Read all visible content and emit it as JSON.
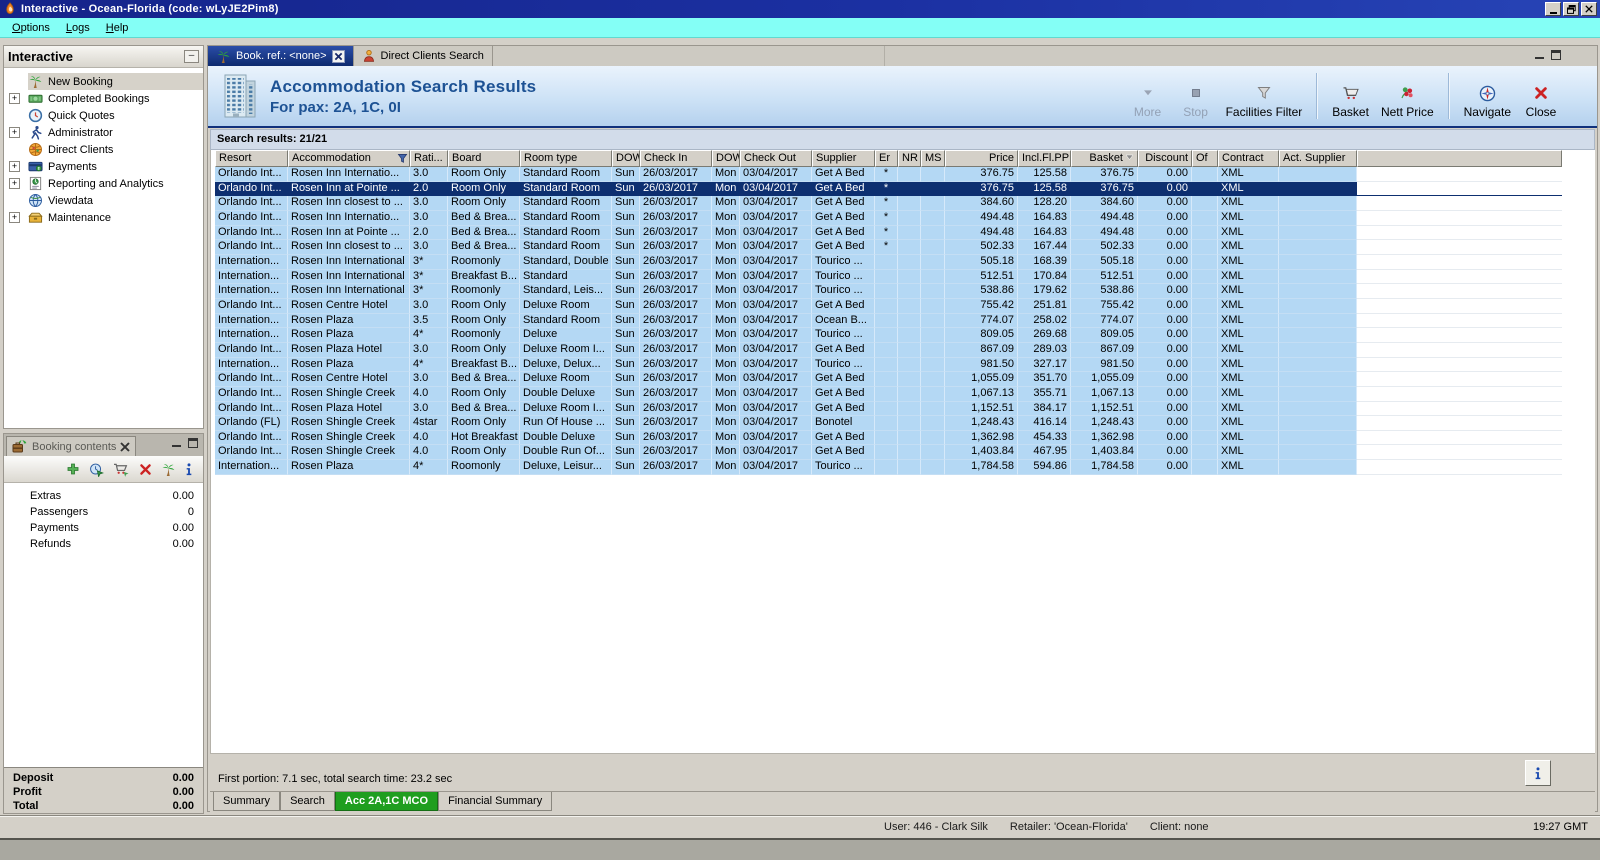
{
  "window": {
    "title": "Interactive - Ocean-Florida (code: wLyJE2Pim8)",
    "menu": [
      "Options",
      "Logs",
      "Help"
    ]
  },
  "sidebar": {
    "title": "Interactive",
    "items": [
      {
        "label": "New Booking",
        "icon": "palm",
        "expandable": false,
        "selected": true
      },
      {
        "label": "Completed Bookings",
        "icon": "money",
        "expandable": true,
        "selected": false
      },
      {
        "label": "Quick Quotes",
        "icon": "clock",
        "expandable": false,
        "selected": false
      },
      {
        "label": "Administrator",
        "icon": "runner",
        "expandable": true,
        "selected": false
      },
      {
        "label": "Direct Clients",
        "icon": "globered",
        "expandable": false,
        "selected": false
      },
      {
        "label": "Payments",
        "icon": "payment",
        "expandable": true,
        "selected": false
      },
      {
        "label": "Reporting and Analytics",
        "icon": "report",
        "expandable": true,
        "selected": false
      },
      {
        "label": "Viewdata",
        "icon": "globeblue",
        "expandable": false,
        "selected": false
      },
      {
        "label": "Maintenance",
        "icon": "box",
        "expandable": true,
        "selected": false
      }
    ]
  },
  "booking_contents": {
    "title": "Booking contents",
    "toolbar": [
      "add",
      "quote",
      "cartadd",
      "remove",
      "palm",
      "info"
    ],
    "rows": [
      {
        "label": "Extras",
        "value": "0.00"
      },
      {
        "label": "Passengers",
        "value": "0"
      },
      {
        "label": "Payments",
        "value": "0.00"
      },
      {
        "label": "Refunds",
        "value": "0.00"
      }
    ],
    "totals": [
      {
        "label": "Deposit",
        "value": "0.00"
      },
      {
        "label": "Profit",
        "value": "0.00"
      },
      {
        "label": "Total",
        "value": "0.00"
      }
    ]
  },
  "status": {
    "user": "User: 446 - Clark Silk",
    "retailer": "Retailer: 'Ocean-Florida'",
    "client": "Client: none",
    "time": "19:27 GMT"
  },
  "main": {
    "tabs": [
      {
        "label": "Book. ref.: <none>",
        "icon": "palm",
        "active": true,
        "closable": true
      },
      {
        "label": "Direct Clients Search",
        "icon": "person",
        "active": false,
        "closable": false
      }
    ],
    "header": {
      "title": "Accommodation Search Results",
      "subtitle": "For pax: 2A, 1C, 0I"
    },
    "toolbar": [
      {
        "label": "More",
        "icon": "more",
        "disabled": true
      },
      {
        "label": "Stop",
        "icon": "stop",
        "disabled": true
      },
      {
        "label": "Facilities Filter",
        "icon": "funnel",
        "disabled": false
      },
      {
        "sep": true
      },
      {
        "label": "Basket",
        "icon": "cart",
        "disabled": false
      },
      {
        "label": "Nett Price",
        "icon": "flower",
        "disabled": false
      },
      {
        "sep": true
      },
      {
        "label": "Navigate",
        "icon": "compass",
        "disabled": false
      },
      {
        "label": "Close",
        "icon": "closex",
        "disabled": false
      }
    ],
    "results": {
      "summary": "Search results: 21/21",
      "timing": "First portion: 7.1 sec, total search time: 23.2 sec"
    },
    "grid": {
      "columns": [
        {
          "label": "Resort"
        },
        {
          "label": "Accommodation",
          "filter": true
        },
        {
          "label": "Rati..."
        },
        {
          "label": "Board"
        },
        {
          "label": "Room type"
        },
        {
          "label": "DOW"
        },
        {
          "label": "Check In"
        },
        {
          "label": "DOW"
        },
        {
          "label": "Check Out"
        },
        {
          "label": "Supplier"
        },
        {
          "label": "Er"
        },
        {
          "label": "NR"
        },
        {
          "label": "MS"
        },
        {
          "label": "Price"
        },
        {
          "label": "Incl.Fl.PP"
        },
        {
          "label": "Basket",
          "sort": "desc"
        },
        {
          "label": "Discount"
        },
        {
          "label": "Of"
        },
        {
          "label": "Contract"
        },
        {
          "label": "Act. Supplier"
        }
      ],
      "selected_index": 1,
      "rows": [
        [
          "Orlando Int...",
          "Rosen Inn Internatio...",
          "3.0",
          "Room Only",
          "Standard Room",
          "Sun",
          "26/03/2017",
          "Mon",
          "03/04/2017",
          "Get A Bed",
          "*",
          "",
          "",
          "376.75",
          "125.58",
          "376.75",
          "0.00",
          "",
          "XML",
          ""
        ],
        [
          "Orlando Int...",
          "Rosen Inn at Pointe ...",
          "2.0",
          "Room Only",
          "Standard Room",
          "Sun",
          "26/03/2017",
          "Mon",
          "03/04/2017",
          "Get A Bed",
          "*",
          "",
          "",
          "376.75",
          "125.58",
          "376.75",
          "0.00",
          "",
          "XML",
          ""
        ],
        [
          "Orlando Int...",
          "Rosen Inn closest to ...",
          "3.0",
          "Room Only",
          "Standard Room",
          "Sun",
          "26/03/2017",
          "Mon",
          "03/04/2017",
          "Get A Bed",
          "*",
          "",
          "",
          "384.60",
          "128.20",
          "384.60",
          "0.00",
          "",
          "XML",
          ""
        ],
        [
          "Orlando Int...",
          "Rosen Inn Internatio...",
          "3.0",
          "Bed & Brea...",
          "Standard Room",
          "Sun",
          "26/03/2017",
          "Mon",
          "03/04/2017",
          "Get A Bed",
          "*",
          "",
          "",
          "494.48",
          "164.83",
          "494.48",
          "0.00",
          "",
          "XML",
          ""
        ],
        [
          "Orlando Int...",
          "Rosen Inn at Pointe ...",
          "2.0",
          "Bed & Brea...",
          "Standard Room",
          "Sun",
          "26/03/2017",
          "Mon",
          "03/04/2017",
          "Get A Bed",
          "*",
          "",
          "",
          "494.48",
          "164.83",
          "494.48",
          "0.00",
          "",
          "XML",
          ""
        ],
        [
          "Orlando Int...",
          "Rosen Inn closest to ...",
          "3.0",
          "Bed & Brea...",
          "Standard Room",
          "Sun",
          "26/03/2017",
          "Mon",
          "03/04/2017",
          "Get A Bed",
          "*",
          "",
          "",
          "502.33",
          "167.44",
          "502.33",
          "0.00",
          "",
          "XML",
          ""
        ],
        [
          "Internation...",
          "Rosen Inn International",
          "3*",
          "Roomonly",
          "Standard, Double",
          "Sun",
          "26/03/2017",
          "Mon",
          "03/04/2017",
          "Tourico ...",
          "",
          "",
          "",
          "505.18",
          "168.39",
          "505.18",
          "0.00",
          "",
          "XML",
          ""
        ],
        [
          "Internation...",
          "Rosen Inn International",
          "3*",
          "Breakfast B...",
          "Standard",
          "Sun",
          "26/03/2017",
          "Mon",
          "03/04/2017",
          "Tourico ...",
          "",
          "",
          "",
          "512.51",
          "170.84",
          "512.51",
          "0.00",
          "",
          "XML",
          ""
        ],
        [
          "Internation...",
          "Rosen Inn International",
          "3*",
          "Roomonly",
          "Standard, Leis...",
          "Sun",
          "26/03/2017",
          "Mon",
          "03/04/2017",
          "Tourico ...",
          "",
          "",
          "",
          "538.86",
          "179.62",
          "538.86",
          "0.00",
          "",
          "XML",
          ""
        ],
        [
          "Orlando Int...",
          "Rosen Centre Hotel",
          "3.0",
          "Room Only",
          "Deluxe Room",
          "Sun",
          "26/03/2017",
          "Mon",
          "03/04/2017",
          "Get A Bed",
          "",
          "",
          "",
          "755.42",
          "251.81",
          "755.42",
          "0.00",
          "",
          "XML",
          ""
        ],
        [
          "Internation...",
          "Rosen Plaza",
          "3.5",
          "Room Only",
          "Standard Room",
          "Sun",
          "26/03/2017",
          "Mon",
          "03/04/2017",
          "Ocean B...",
          "",
          "",
          "",
          "774.07",
          "258.02",
          "774.07",
          "0.00",
          "",
          "XML",
          ""
        ],
        [
          "Internation...",
          "Rosen Plaza",
          "4*",
          "Roomonly",
          "Deluxe",
          "Sun",
          "26/03/2017",
          "Mon",
          "03/04/2017",
          "Tourico ...",
          "",
          "",
          "",
          "809.05",
          "269.68",
          "809.05",
          "0.00",
          "",
          "XML",
          ""
        ],
        [
          "Orlando Int...",
          "Rosen Plaza Hotel",
          "3.0",
          "Room Only",
          "Deluxe Room I...",
          "Sun",
          "26/03/2017",
          "Mon",
          "03/04/2017",
          "Get A Bed",
          "",
          "",
          "",
          "867.09",
          "289.03",
          "867.09",
          "0.00",
          "",
          "XML",
          ""
        ],
        [
          "Internation...",
          "Rosen Plaza",
          "4*",
          "Breakfast B...",
          "Deluxe, Delux...",
          "Sun",
          "26/03/2017",
          "Mon",
          "03/04/2017",
          "Tourico ...",
          "",
          "",
          "",
          "981.50",
          "327.17",
          "981.50",
          "0.00",
          "",
          "XML",
          ""
        ],
        [
          "Orlando Int...",
          "Rosen Centre Hotel",
          "3.0",
          "Bed & Brea...",
          "Deluxe Room",
          "Sun",
          "26/03/2017",
          "Mon",
          "03/04/2017",
          "Get A Bed",
          "",
          "",
          "",
          "1,055.09",
          "351.70",
          "1,055.09",
          "0.00",
          "",
          "XML",
          ""
        ],
        [
          "Orlando Int...",
          "Rosen Shingle Creek",
          "4.0",
          "Room Only",
          "Double Deluxe",
          "Sun",
          "26/03/2017",
          "Mon",
          "03/04/2017",
          "Get A Bed",
          "",
          "",
          "",
          "1,067.13",
          "355.71",
          "1,067.13",
          "0.00",
          "",
          "XML",
          ""
        ],
        [
          "Orlando Int...",
          "Rosen Plaza Hotel",
          "3.0",
          "Bed & Brea...",
          "Deluxe Room I...",
          "Sun",
          "26/03/2017",
          "Mon",
          "03/04/2017",
          "Get A Bed",
          "",
          "",
          "",
          "1,152.51",
          "384.17",
          "1,152.51",
          "0.00",
          "",
          "XML",
          ""
        ],
        [
          "Orlando (FL)",
          "Rosen Shingle Creek",
          "4star",
          "Room Only",
          "Run Of House ...",
          "Sun",
          "26/03/2017",
          "Mon",
          "03/04/2017",
          "Bonotel",
          "",
          "",
          "",
          "1,248.43",
          "416.14",
          "1,248.43",
          "0.00",
          "",
          "XML",
          ""
        ],
        [
          "Orlando Int...",
          "Rosen Shingle Creek",
          "4.0",
          "Hot Breakfast",
          "Double Deluxe",
          "Sun",
          "26/03/2017",
          "Mon",
          "03/04/2017",
          "Get A Bed",
          "",
          "",
          "",
          "1,362.98",
          "454.33",
          "1,362.98",
          "0.00",
          "",
          "XML",
          ""
        ],
        [
          "Orlando Int...",
          "Rosen Shingle Creek",
          "4.0",
          "Room Only",
          "Double Run Of...",
          "Sun",
          "26/03/2017",
          "Mon",
          "03/04/2017",
          "Get A Bed",
          "",
          "",
          "",
          "1,403.84",
          "467.95",
          "1,403.84",
          "0.00",
          "",
          "XML",
          ""
        ],
        [
          "Internation...",
          "Rosen Plaza",
          "4*",
          "Roomonly",
          "Deluxe, Leisur...",
          "Sun",
          "26/03/2017",
          "Mon",
          "03/04/2017",
          "Tourico ...",
          "",
          "",
          "",
          "1,784.58",
          "594.86",
          "1,784.58",
          "0.00",
          "",
          "XML",
          ""
        ]
      ]
    },
    "bottom_tabs": {
      "items": [
        "Summary",
        "Search",
        "Acc 2A,1C MCO",
        "Financial Summary"
      ],
      "active_index": 2
    }
  }
}
